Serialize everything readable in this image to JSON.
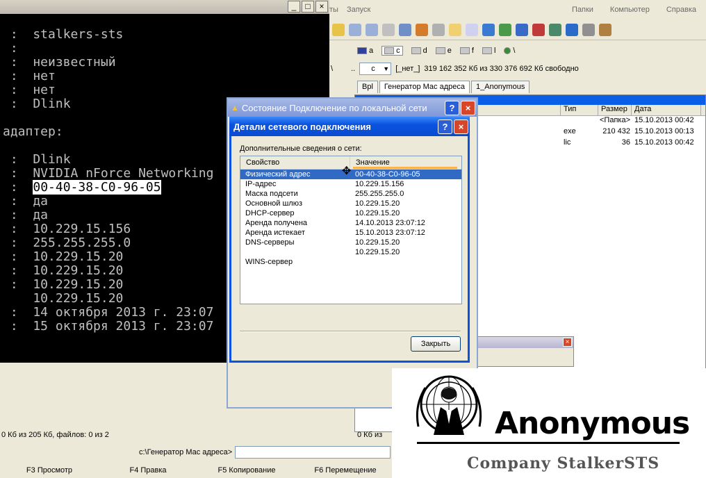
{
  "console": {
    "lines": [
      {
        "text": " :  stalkers-sts"
      },
      {
        "text": " :"
      },
      {
        "text": " :  неизвестный"
      },
      {
        "text": " :  нет"
      },
      {
        "text": " :  нет"
      },
      {
        "text": " :  Dlink"
      },
      {
        "text": ""
      },
      {
        "text": "адаптер:"
      },
      {
        "text": ""
      },
      {
        "text": " :  Dlink"
      },
      {
        "text": " :  NVIDIA nForce Networking"
      },
      {
        "text": " :  ",
        "highlight": "00-40-38-C0-96-05"
      },
      {
        "text": " :  да"
      },
      {
        "text": " :  да"
      },
      {
        "text": " :  10.229.15.156"
      },
      {
        "text": " :  255.255.255.0"
      },
      {
        "text": " :  10.229.15.20"
      },
      {
        "text": " :  10.229.15.20"
      },
      {
        "text": " :  10.229.15.20"
      },
      {
        "text": "    10.229.15.20"
      },
      {
        "text": " :  14 октября 2013 г. 23:07"
      },
      {
        "text": " :  15 октября 2013 г. 23:07"
      }
    ],
    "btn_min": "_",
    "btn_max": "□",
    "btn_close": "×"
  },
  "file_manager": {
    "menu_left": [
      "ты",
      "Запуск"
    ],
    "menu_right": [
      "Папки",
      "Компьютер",
      "Справка"
    ],
    "drives": [
      "a",
      "c",
      "d",
      "e",
      "f",
      "l",
      "\\"
    ],
    "path_drive": "c",
    "path_label": "[_нет_]",
    "free_space": "319 162 352 Кб из 330 376 692 Кб свободно",
    "tabs": [
      "Bpl",
      "Генератор Мас адреса",
      "1_Anonymous"
    ],
    "columns": {
      "type": "Тип",
      "size": "Размер",
      "date": "Дата"
    },
    "rows": [
      {
        "type": "",
        "size": "<Папка>",
        "date": "15.10.2013 00:42"
      },
      {
        "type": "exe",
        "size": "210 432",
        "date": "15.10.2013 00:13"
      },
      {
        "type": "lic",
        "size": "36",
        "date": "15.10.2013 00:42"
      }
    ],
    "status_left": "0 Кб из 205 Кб, файлов: 0 из 2",
    "status_right": "0 Кб из",
    "cmd_path": "c:\\Генератор Мас адреса>",
    "fkeys": [
      "F3 Просмотр",
      "F4 Правка",
      "F5 Копирование",
      "F6 Перемещение"
    ]
  },
  "status_window": {
    "title": "Состояние Подключение по локальной сети",
    "help": "?",
    "close": "×"
  },
  "details_dialog": {
    "title": "Детали сетевого подключения",
    "help": "?",
    "close": "×",
    "subtitle": "Дополнительные сведения о сети:",
    "col_property": "Свойство",
    "col_value": "Значение",
    "rows": [
      {
        "property": "Физический адрес",
        "value": "00-40-38-C0-96-05",
        "selected": true
      },
      {
        "property": "IP-адрес",
        "value": "10.229.15.156"
      },
      {
        "property": "Маска подсети",
        "value": "255.255.255.0"
      },
      {
        "property": "Основной шлюз",
        "value": "10.229.15.20"
      },
      {
        "property": "DHCP-сервер",
        "value": "10.229.15.20"
      },
      {
        "property": "Аренда получена",
        "value": "14.10.2013 23:07:12"
      },
      {
        "property": "Аренда истекает",
        "value": "15.10.2013 23:07:12"
      },
      {
        "property": "DNS-серверы",
        "value": "10.229.15.20"
      },
      {
        "property": "",
        "value": "10.229.15.20"
      },
      {
        "property": "WINS-сервер",
        "value": ""
      }
    ],
    "close_button": "Закрыть"
  },
  "overlay": {
    "word": "Anonymous",
    "company": "Company StalkerSTS"
  },
  "colors": {
    "xp_title": "#0a53e0",
    "selection": "#316ac5",
    "console_bg": "#000000"
  }
}
